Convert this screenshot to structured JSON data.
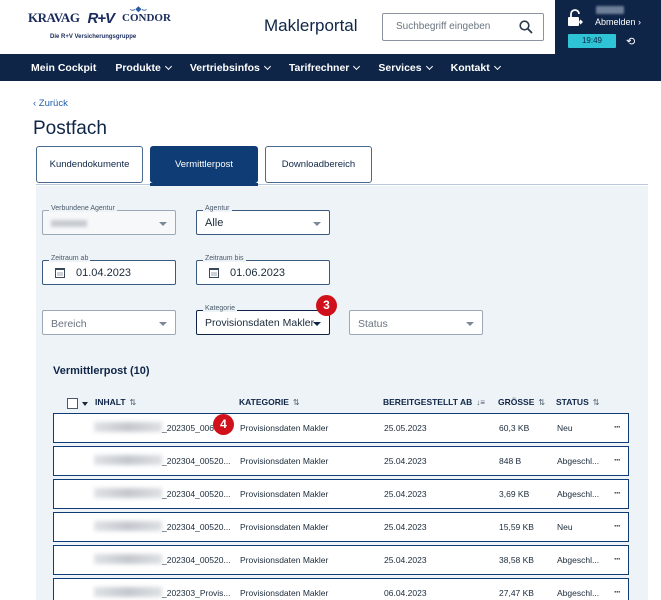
{
  "header": {
    "logos": [
      "KRAVAG",
      "R+V",
      "CONDOR"
    ],
    "logo_sub": "Die R+V Versicherungsgruppe",
    "portal_title": "Maklerportal",
    "search": {
      "placeholder": "Suchbegriff eingeben",
      "icon": "search-icon"
    },
    "user": {
      "logout_label": "Abmelden ›",
      "timer": "19:49",
      "refresh_icon": "refresh-icon",
      "lock_icon": "lock-icon"
    }
  },
  "nav": {
    "items": [
      {
        "label": "Mein Cockpit",
        "dropdown": false
      },
      {
        "label": "Produkte",
        "dropdown": true
      },
      {
        "label": "Vertriebsinfos",
        "dropdown": true
      },
      {
        "label": "Tarifrechner",
        "dropdown": true
      },
      {
        "label": "Services",
        "dropdown": true
      },
      {
        "label": "Kontakt",
        "dropdown": true
      }
    ]
  },
  "page": {
    "back_label": "‹ Zurück",
    "title": "Postfach",
    "tabs": [
      {
        "label": "Kundendokumente",
        "active": false
      },
      {
        "label": "Vermittlerpost",
        "active": true
      },
      {
        "label": "Downloadbereich",
        "active": false
      }
    ]
  },
  "filters": {
    "verbundene_agentur": {
      "label": "Verbundene Agentur",
      "value": ""
    },
    "agentur": {
      "label": "Agentur",
      "value": "Alle"
    },
    "zeitraum_ab": {
      "label": "Zeitraum ab",
      "value": "01.04.2023"
    },
    "zeitraum_bis": {
      "label": "Zeitraum bis",
      "value": "01.06.2023"
    },
    "bereich": {
      "placeholder": "Bereich"
    },
    "kategorie": {
      "label": "Kategorie",
      "value": "Provisionsdaten Makler"
    },
    "status": {
      "placeholder": "Status"
    }
  },
  "badges": {
    "kategorie": "3",
    "first_row": "4"
  },
  "table": {
    "title": "Vermittlerpost (10)",
    "columns": [
      "INHALT",
      "KATEGORIE",
      "BEREITGESTELLT AB",
      "GRÖSSE",
      "STATUS"
    ],
    "sort_icons": [
      "⇅",
      "⇅",
      "↓≡",
      "⇅",
      "⇅"
    ],
    "rows": [
      {
        "inhalt": "_202305_006",
        "kategorie": "Provisionsdaten Makler",
        "datum": "25.05.2023",
        "groesse": "60,3 KB",
        "status": "Neu",
        "more": "···"
      },
      {
        "inhalt": "_202304_00520...",
        "kategorie": "Provisionsdaten Makler",
        "datum": "25.04.2023",
        "groesse": "848 B",
        "status": "Abgeschl...",
        "more": "···"
      },
      {
        "inhalt": "_202304_00520...",
        "kategorie": "Provisionsdaten Makler",
        "datum": "25.04.2023",
        "groesse": "3,69 KB",
        "status": "Abgeschl...",
        "more": "···"
      },
      {
        "inhalt": "_202304_00520...",
        "kategorie": "Provisionsdaten Makler",
        "datum": "25.04.2023",
        "groesse": "15,59 KB",
        "status": "Neu",
        "more": "···"
      },
      {
        "inhalt": "_202304_00520...",
        "kategorie": "Provisionsdaten Makler",
        "datum": "25.04.2023",
        "groesse": "38,58 KB",
        "status": "Abgeschl...",
        "more": "···"
      },
      {
        "inhalt": "_202303_Provis...",
        "kategorie": "Provisionsdaten Makler",
        "datum": "06.04.2023",
        "groesse": "27,47 KB",
        "status": "Abgeschl...",
        "more": "···"
      }
    ]
  },
  "colors": {
    "primary": "#0f2547",
    "accent": "#0f3c74",
    "timer": "#2ec4d6",
    "badge": "#d0101a",
    "panel": "#eef3f8"
  }
}
